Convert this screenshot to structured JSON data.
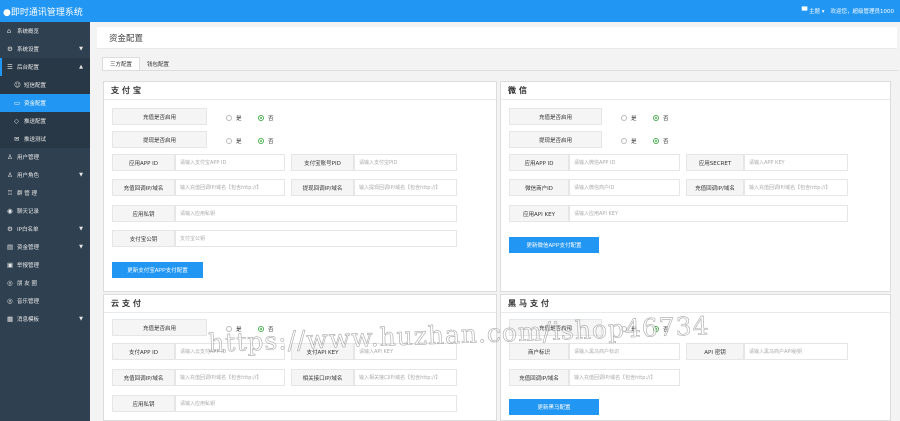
{
  "app": {
    "title": "●即时通讯管理系统"
  },
  "topbar": {
    "theme_label": "主题",
    "welcome": "欢迎您，超级管理员1000"
  },
  "sidebar": {
    "items": [
      {
        "label": "系统概览",
        "icon": "home-icon"
      },
      {
        "label": "系统设置",
        "icon": "gear-icon",
        "arrow": "▼"
      },
      {
        "label": "后台配置",
        "icon": "sliders-icon",
        "arrow": "▲"
      },
      {
        "label": "用户管理",
        "icon": "user-icon"
      },
      {
        "label": "用户角色",
        "icon": "users-icon",
        "arrow": "▼"
      },
      {
        "label": "群 管 理",
        "icon": "group-icon"
      },
      {
        "label": "聊天记录",
        "icon": "chat-icon"
      },
      {
        "label": "IP白名单",
        "icon": "shield-icon",
        "arrow": "▼"
      },
      {
        "label": "资金管理",
        "icon": "wallet-icon",
        "arrow": "▼"
      },
      {
        "label": "举报管理",
        "icon": "report-icon"
      },
      {
        "label": "朋 友 圈",
        "icon": "circle-icon"
      },
      {
        "label": "音乐管理",
        "icon": "music-icon"
      },
      {
        "label": "消息模板",
        "icon": "template-icon",
        "arrow": "▼"
      }
    ],
    "sub": [
      {
        "label": "短信配置",
        "icon": "sms-icon"
      },
      {
        "label": "资金配置",
        "icon": "money-icon"
      },
      {
        "label": "推送配置",
        "icon": "tag-icon"
      },
      {
        "label": "推送测试",
        "icon": "mail-icon"
      }
    ]
  },
  "page": {
    "title": "资金配置",
    "tabs": [
      "三方配置",
      "钱包配置"
    ]
  },
  "radio": {
    "yes": "是",
    "no": "否"
  },
  "alipay": {
    "title": "支付宝",
    "recharge_label": "充值是否启用",
    "withdraw_label": "提现是否启用",
    "appid_label": "应用APP ID",
    "appid_ph": "请输入支付宝APP ID",
    "account_label": "支付宝账号PID",
    "account_ph": "请输入支付宝PID",
    "notify_label": "充值回调IP/域名",
    "notify_ph": "输入充值回调IP/域名【包含http://】",
    "wnotify_label": "提现回调IP/域名",
    "wnotify_ph": "输入提现回调IP/域名【包含http://】",
    "privkey_label": "应用私钥",
    "privkey_ph": "请输入应用私钥",
    "pubkey_label": "支付宝公钥",
    "pubkey_ph": "支付宝公钥",
    "button": "更新支付宝APP支付配置"
  },
  "wechat": {
    "title": "微信",
    "recharge_label": "充值是否启用",
    "withdraw_label": "提现是否启用",
    "appid_label": "应用APP ID",
    "appid_ph": "请输入微信APP ID",
    "secret_label": "应用SECRET",
    "secret_ph": "请输入APP KEY",
    "mch_label": "微信商户ID",
    "mch_ph": "请输入微信商户ID",
    "notify_label": "充值回调IP/域名",
    "notify_ph": "输入充值回调IP/域名【包含http://】",
    "apikey_label": "应用API KEY",
    "apikey_ph": "请输入应用API KEY",
    "button": "更新微信APP支付配置"
  },
  "yunpay": {
    "title": "云支付",
    "recharge_label": "充值是否启用",
    "appid_label": "支付APP ID",
    "appid_ph": "请输入云支付APP ID",
    "apikey_label": "支付API KEY",
    "apikey_ph": "请输入API KEY",
    "notify_label": "充值回调IP/域名",
    "notify_ph": "输入充值回调IP/域名【包含http://】",
    "relay_label": "相关接口IP/域名",
    "relay_ph": "输入相关接口IP/域名【包含http://】",
    "privkey_label": "应用私钥",
    "privkey_ph": "请输入应用私钥"
  },
  "heima": {
    "title": "黑马支付",
    "recharge_label": "充值是否启用",
    "mch_label": "商户标识",
    "mch_ph": "请输入黑马商户标识",
    "apikey_label": "API 密钥",
    "apikey_ph": "请输入黑马商户API秘钥",
    "notify_label": "充值回调IP/域名",
    "notify_ph": "输入充值回调IP/域名【包含http://】",
    "button": "更新黑马配置"
  },
  "watermark": "https://www.huzhan.com/ishop46734"
}
